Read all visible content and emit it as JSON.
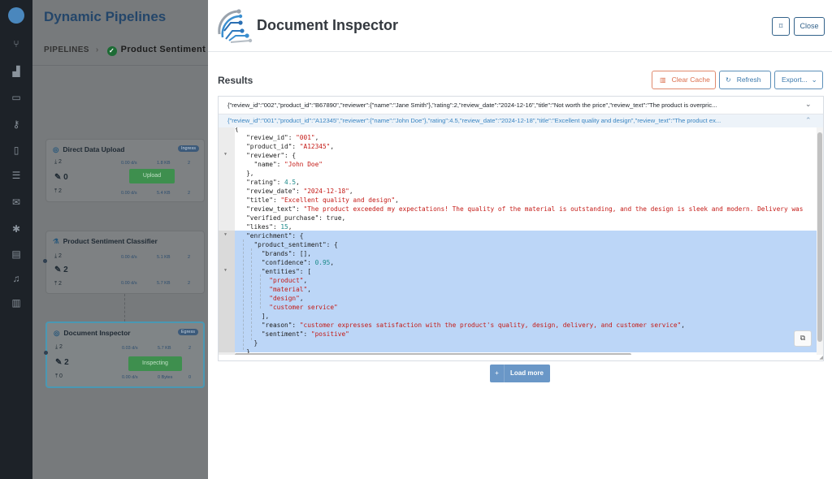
{
  "background": {
    "app_title": "Dynamic Pipelines",
    "breadcrumb_root": "PIPELINES",
    "breadcrumb_current": "Product Sentiment Class",
    "nodes": [
      {
        "name": "Direct Data Upload",
        "badge": "Ingress",
        "in_count": "2",
        "edit_count": "0",
        "out_count": "2",
        "button": "Upload",
        "rate1": "0.00 d/s",
        "size1": "1.8 KB",
        "count1": "2",
        "rate2": "0.00 d/s",
        "size2": "5.4 KB",
        "count2": "2"
      },
      {
        "name": "Product Sentiment Classifier",
        "badge": "",
        "in_count": "2",
        "edit_count": "2",
        "out_count": "2",
        "button": "",
        "rate1": "0.00 d/s",
        "size1": "5.1 KB",
        "count1": "2",
        "rate2": "0.00 d/s",
        "size2": "5.7 KB",
        "count2": "2"
      },
      {
        "name": "Document Inspector",
        "badge": "Egress",
        "in_count": "2",
        "edit_count": "2",
        "out_count": "0",
        "button": "Inspecting",
        "rate1": "0.03 d/s",
        "size1": "5.7 KB",
        "count1": "2",
        "rate2": "0.00 d/s",
        "size2": "0 Bytes",
        "count2": "0"
      }
    ]
  },
  "panel": {
    "title": "Document Inspector",
    "expand_label": "⌑",
    "close_label": "Close",
    "results_title": "Results",
    "toolbar": {
      "clear_cache": "Clear Cache",
      "refresh": "Refresh",
      "export": "Export..."
    },
    "records": [
      {
        "summary": "{\"review_id\":\"002\",\"product_id\":\"B67890\",\"reviewer\":{\"name\":\"Jane Smith\"},\"rating\":2,\"review_date\":\"2024-12-16\",\"title\":\"Not worth the price\",\"review_text\":\"The product is overpric...",
        "expanded": false
      },
      {
        "summary": "{\"review_id\":\"001\",\"product_id\":\"A12345\",\"reviewer\":{\"name\":\"John Doe\"},\"rating\":4.5,\"review_date\":\"2024-12-18\",\"title\":\"Excellent quality and design\",\"review_text\":\"The product ex...",
        "expanded": true
      }
    ],
    "json": {
      "review_id": "\"001\"",
      "product_id": "\"A12345\"",
      "reviewer_name": "\"John Doe\"",
      "rating": "4.5",
      "review_date": "\"2024-12-18\"",
      "title": "\"Excellent quality and design\"",
      "review_text": "\"The product exceeded my expectations! The quality of the material is outstanding, and the design is sleek and modern. Delivery was",
      "verified_purchase": "true",
      "likes": "15",
      "brands": "[]",
      "confidence": "0.95",
      "entities": [
        "\"product\"",
        "\"material\"",
        "\"design\"",
        "\"customer service\""
      ],
      "reason": "\"customer expresses satisfaction with the product's quality, design, delivery, and customer service\"",
      "sentiment": "\"positive\""
    },
    "load_more": "Load more"
  },
  "colors": {
    "accent": "#3d7aad",
    "clear_cache": "#db6d4b",
    "selection": "#bcd6f7",
    "json_string": "#c41a16",
    "json_number": "#1c8a8a",
    "load_more": "#6a97c7"
  }
}
